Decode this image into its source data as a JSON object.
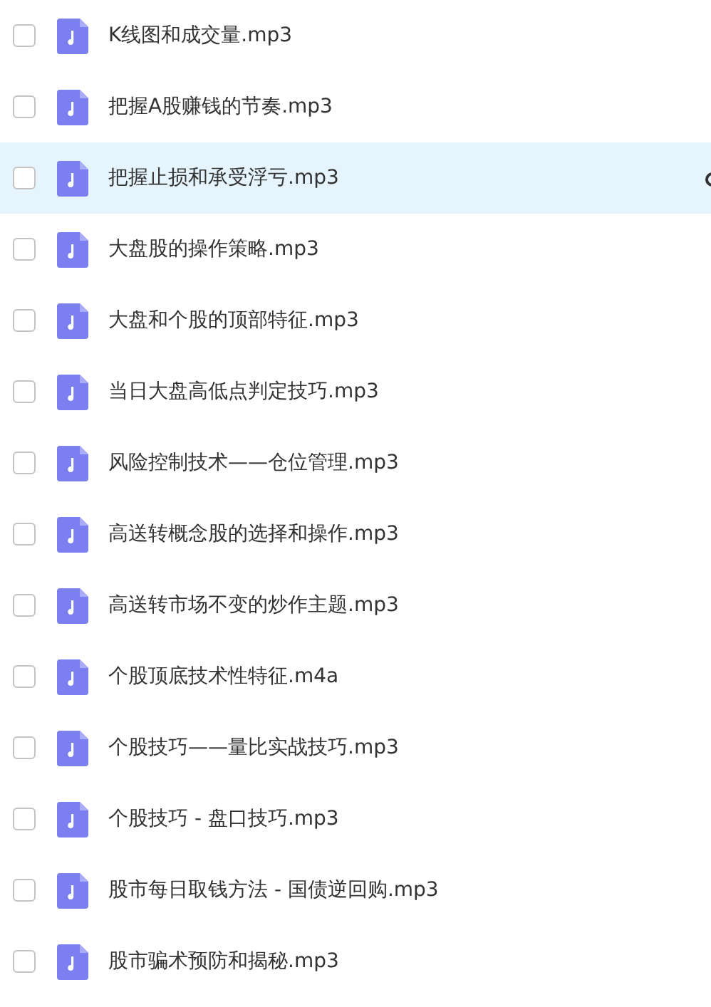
{
  "files": [
    {
      "name": "K线图和成交量.mp3",
      "checked": false,
      "highlighted": false
    },
    {
      "name": "把握A股赚钱的节奏.mp3",
      "checked": false,
      "highlighted": false
    },
    {
      "name": "把握止损和承受浮亏.mp3",
      "checked": false,
      "highlighted": true
    },
    {
      "name": "大盘股的操作策略.mp3",
      "checked": false,
      "highlighted": false
    },
    {
      "name": "大盘和个股的顶部特征.mp3",
      "checked": false,
      "highlighted": false
    },
    {
      "name": "当日大盘高低点判定技巧.mp3",
      "checked": false,
      "highlighted": false
    },
    {
      "name": "风险控制技术——仓位管理.mp3",
      "checked": false,
      "highlighted": false
    },
    {
      "name": "高送转概念股的选择和操作.mp3",
      "checked": false,
      "highlighted": false
    },
    {
      "name": "高送转市场不变的炒作主题.mp3",
      "checked": false,
      "highlighted": false
    },
    {
      "name": "个股顶底技术性特征.m4a",
      "checked": false,
      "highlighted": false
    },
    {
      "name": "个股技巧——量比实战技巧.mp3",
      "checked": false,
      "highlighted": false
    },
    {
      "name": "个股技巧 - 盘口技巧.mp3",
      "checked": false,
      "highlighted": false
    },
    {
      "name": "股市每日取钱方法 - 国债逆回购.mp3",
      "checked": false,
      "highlighted": false
    },
    {
      "name": "股市骗术预防和揭秘.mp3",
      "checked": false,
      "highlighted": false
    }
  ]
}
